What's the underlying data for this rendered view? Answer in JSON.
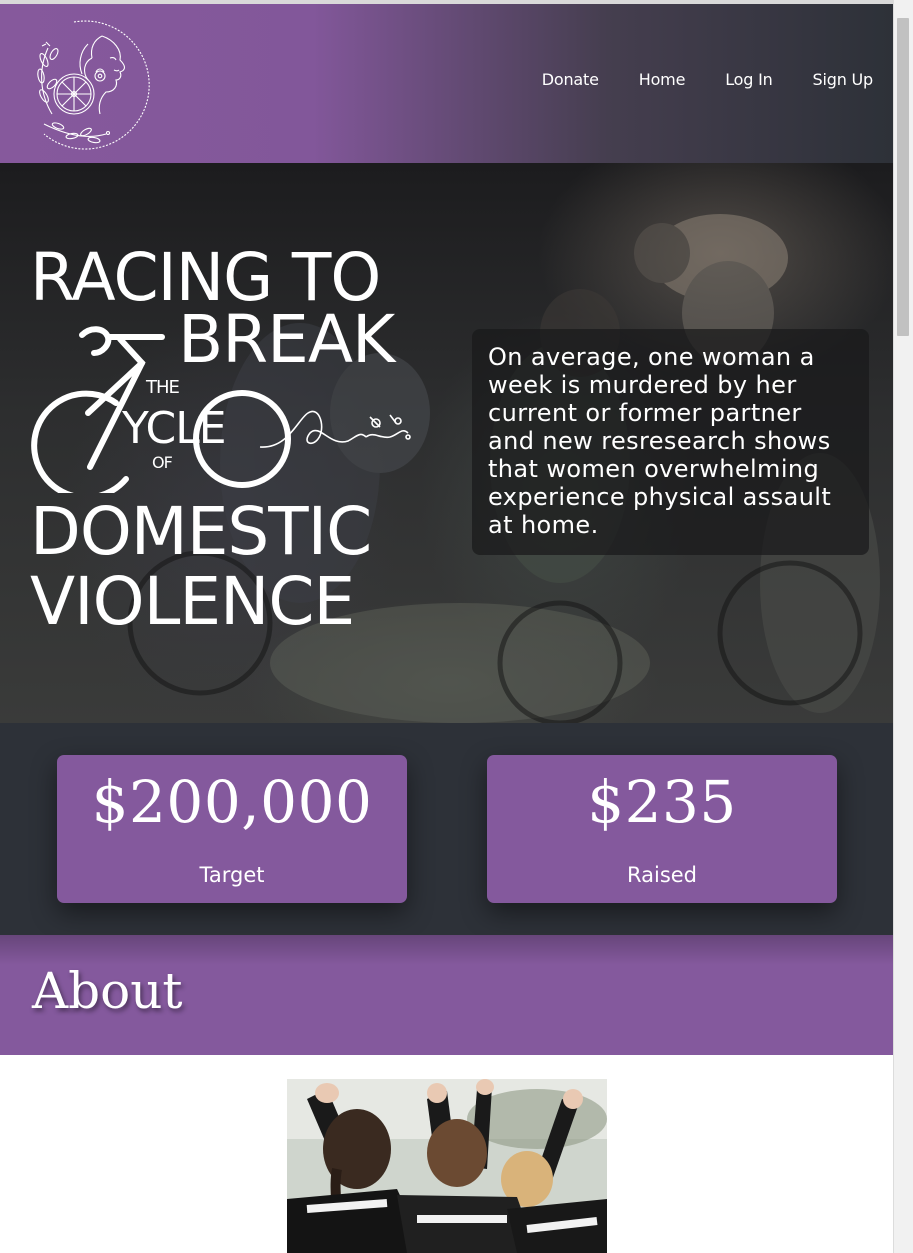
{
  "nav": {
    "items": [
      "Donate",
      "Home",
      "Log In",
      "Sign Up"
    ]
  },
  "hero": {
    "title": {
      "line1": "RACING TO",
      "line2": "BREAK",
      "the": "THE",
      "cycle": "YCLE",
      "of": "OF",
      "line4": "DOMESTIC",
      "line5": "VIOLENCE"
    },
    "stat_text": "On average, one woman a week is murdered by her current or former partner and new resresearch shows that women overwhelming experience physical assault at home."
  },
  "fundraising": {
    "target": {
      "amount": "$200,000",
      "label": "Target"
    },
    "raised": {
      "amount": "$235",
      "label": "Raised"
    }
  },
  "about": {
    "heading": "About"
  },
  "colors": {
    "brand_purple": "#84599d",
    "dark_slate": "#2d3138",
    "text_white": "#ffffff"
  },
  "icons": {
    "logo": "woman-face-bicycle-wheel-floral-logo",
    "hero_graphic": "bicycle-cycle-script-graphic"
  }
}
